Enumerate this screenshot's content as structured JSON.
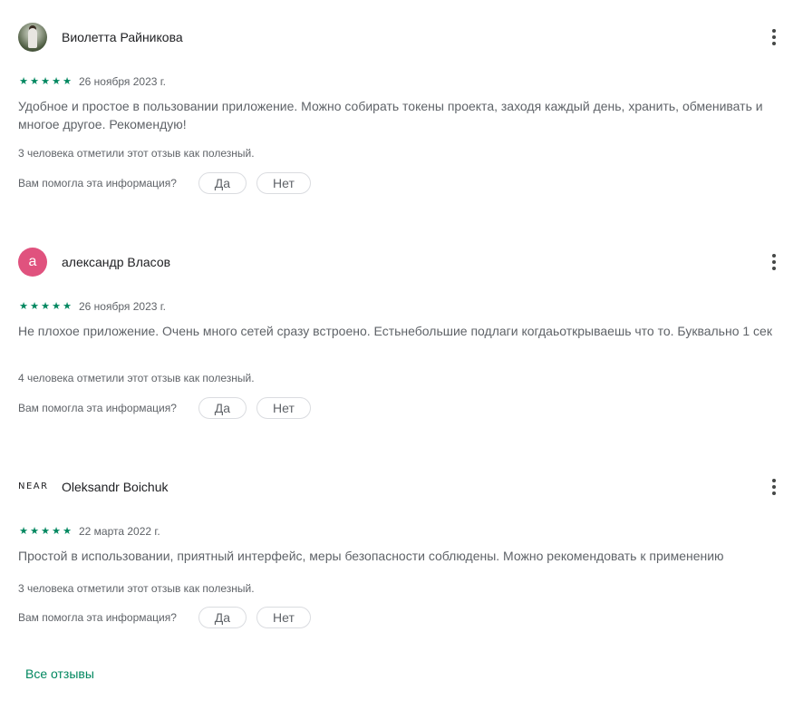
{
  "reviews": [
    {
      "author": "Виолетта Райникова",
      "avatar_type": "photo",
      "rating": 5,
      "stars": "★★★★★",
      "date": "26 ноября 2023 г.",
      "text": "Удобное и простое в пользовании приложение. Можно собирать токены проекта, заходя каждый день, хранить, обменивать и многое другое. Рекомендую!",
      "helpful_count": "3 человека отметили этот отзыв как полезный.",
      "helpful_question": "Вам помогла эта информация?",
      "yes_label": "Да",
      "no_label": "Нет"
    },
    {
      "author": "александр Власов",
      "avatar_type": "letter",
      "avatar_letter": "а",
      "avatar_color": "#e0527e",
      "rating": 5,
      "stars": "★★★★★",
      "date": "26 ноября 2023 г.",
      "text": "Не плохое приложение. Очень много сетей сразу встроено. Естьнебольшие подлаги когдаьоткрываешь что то. Буквально 1 сек",
      "helpful_count": "4 человека отметили этот отзыв как полезный.",
      "helpful_question": "Вам помогла эта информация?",
      "yes_label": "Да",
      "no_label": "Нет"
    },
    {
      "author": "Oleksandr Boichuk",
      "avatar_type": "logo",
      "avatar_logo_text": "NEAR",
      "rating": 5,
      "stars": "★★★★★",
      "date": "22 марта 2022 г.",
      "text": "Простой в использовании, приятный интерфейс, меры безопасности соблюдены. Можно рекомендовать к применению",
      "helpful_count": "3 человека отметили этот отзыв как полезный.",
      "helpful_question": "Вам помогла эта информация?",
      "yes_label": "Да",
      "no_label": "Нет"
    }
  ],
  "all_reviews_label": "Все отзывы",
  "colors": {
    "accent": "#01875f",
    "text_primary": "#202124",
    "text_secondary": "#5f6368",
    "button_border": "#dadce0"
  },
  "icons": {
    "more": "more-vert-icon",
    "star": "star-icon"
  }
}
